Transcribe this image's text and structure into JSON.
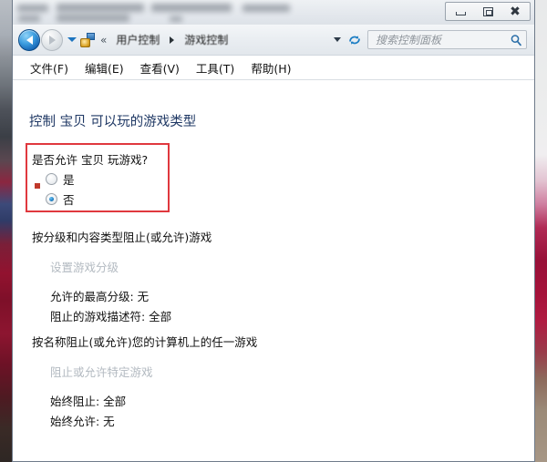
{
  "window": {
    "titlebar_redacted": true,
    "controls": {
      "minimize": "最小化",
      "maximize": "还原",
      "close": "关闭"
    }
  },
  "navbar": {
    "back_tooltip": "后退",
    "forward_tooltip": "前进",
    "chevrons": "«",
    "breadcrumbs": [
      {
        "label": "用户控制"
      },
      {
        "label": "游戏控制"
      }
    ],
    "search": {
      "placeholder": "搜索控制面板",
      "value": ""
    }
  },
  "menubar": {
    "items": [
      {
        "label": "文件(F)"
      },
      {
        "label": "编辑(E)"
      },
      {
        "label": "查看(V)"
      },
      {
        "label": "工具(T)"
      },
      {
        "label": "帮助(H)"
      }
    ]
  },
  "content": {
    "page_title": "控制 宝贝 可以玩的游戏类型",
    "allow_games": {
      "question": "是否允许 宝贝 玩游戏?",
      "options": [
        {
          "label": "是",
          "selected": false
        },
        {
          "label": "否",
          "selected": true
        }
      ],
      "highlight_color": "#e0383e"
    },
    "ratings_section": {
      "heading": "按分级和内容类型阻止(或允许)游戏",
      "link": "设置游戏分级",
      "details": [
        "允许的最高分级:  无",
        "阻止的游戏描述符: 全部"
      ]
    },
    "names_section": {
      "heading": "按名称阻止(或允许)您的计算机上的任一游戏",
      "link": "阻止或允许特定游戏",
      "details": [
        "始终阻止: 全部",
        "始终允许: 无"
      ]
    }
  },
  "colors": {
    "heading": "#1f3864",
    "annotation": "#e0383e",
    "disabled_link": "#b3bac1"
  }
}
